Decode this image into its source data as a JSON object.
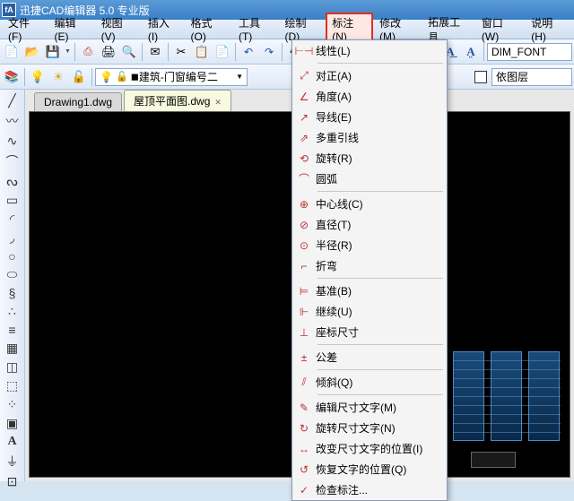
{
  "title": "迅捷CAD编辑器 5.0 专业版",
  "menu": [
    "文件(F)",
    "编辑(E)",
    "视图(V)",
    "插入(I)",
    "格式(O)",
    "工具(T)",
    "绘制(D)",
    "标注(N)",
    "修改(M)",
    "拓展工具",
    "窗口(W)",
    "说明(H)"
  ],
  "layer_display": "建筑-门窗编号二",
  "font_display": "DIM_FONT",
  "bylayer": "依图层",
  "tabs": [
    {
      "label": "Drawing1.dwg",
      "active": false
    },
    {
      "label": "屋顶平面图.dwg",
      "active": true
    }
  ],
  "dropdown": [
    {
      "icon": "dim-linear",
      "label": "线性(L)"
    },
    {
      "sep": true
    },
    {
      "icon": "dim-align",
      "label": "对正(A)"
    },
    {
      "icon": "dim-angle",
      "label": "角度(A)"
    },
    {
      "icon": "dim-leader",
      "label": "导线(E)"
    },
    {
      "icon": "dim-mleader",
      "label": "多重引线"
    },
    {
      "icon": "dim-rotate",
      "label": "旋转(R)"
    },
    {
      "icon": "dim-arc",
      "label": "圆弧"
    },
    {
      "sep": true
    },
    {
      "icon": "dim-center",
      "label": "中心线(C)"
    },
    {
      "icon": "dim-diam",
      "label": "直径(T)"
    },
    {
      "icon": "dim-radius",
      "label": "半径(R)"
    },
    {
      "icon": "dim-jog",
      "label": "折弯"
    },
    {
      "sep": true
    },
    {
      "icon": "dim-base",
      "label": "基准(B)"
    },
    {
      "icon": "dim-cont",
      "label": "继续(U)"
    },
    {
      "icon": "dim-ord",
      "label": "座标尺寸"
    },
    {
      "sep": true
    },
    {
      "icon": "dim-tol",
      "label": "公差"
    },
    {
      "sep": true
    },
    {
      "icon": "dim-obl",
      "label": "倾斜(Q)"
    },
    {
      "sep": true
    },
    {
      "icon": "dim-edit",
      "label": "编辑尺寸文字(M)"
    },
    {
      "icon": "dim-rot",
      "label": "旋转尺寸文字(N)"
    },
    {
      "icon": "dim-pos",
      "label": "改变尺寸文字的位置(I)"
    },
    {
      "icon": "dim-rest",
      "label": "恢复文字的位置(Q)"
    },
    {
      "icon": "dim-chk",
      "label": "检查标注..."
    }
  ]
}
